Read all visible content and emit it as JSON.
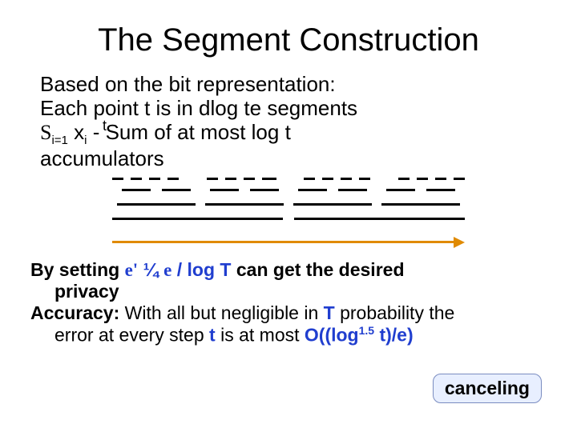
{
  "title": "The Segment Construction",
  "body": {
    "line1": "Based on the bit representation:",
    "line2_pre": "Each point ",
    "line2_t": "t",
    "line2_mid": " is in ",
    "line2_lceil": "d",
    "line2_log": "log t",
    "line2_rceil": "e",
    "line2_post": " segments",
    "sigma": "S",
    "sigma_sup": "t",
    "sigma_sub": "i=1",
    "sigma_x": " x",
    "sigma_xi": "i",
    "sigma_rest": " - Sum of at most ",
    "sigma_log": "log t",
    "acc": "accumulators"
  },
  "lower": {
    "l1_pre": "By setting ",
    "eps_prime": "e'",
    "quarter": " ¼ ",
    "eps": "e",
    "slash": " / ",
    "logT": "log T",
    "l1_post": "  can get the desired",
    "l2": "privacy",
    "l3_pre": "Accuracy:",
    "l3_mid": "  With all but negligible in ",
    "l3_T": "T",
    "l3_post": " probability the",
    "l4_pre": "error at every step ",
    "l4_t": "t",
    "l4_mid": " is at most  ",
    "l4_O": "O((log",
    "l4_exp": "1.5",
    "l4_tail": " t)/e)"
  },
  "callout": "canceling"
}
